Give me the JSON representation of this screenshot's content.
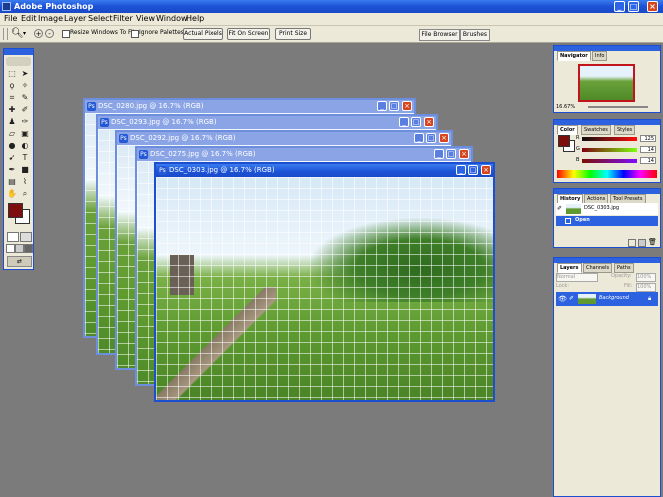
{
  "app": {
    "title": "Adobe Photoshop"
  },
  "menu": [
    "File",
    "Edit",
    "Image",
    "Layer",
    "Select",
    "Filter",
    "View",
    "Window",
    "Help"
  ],
  "options": {
    "resize_label": "Resize Windows To Fit",
    "ignore_label": "Ignore Palettes",
    "actual_pixels": "Actual Pixels",
    "fit_on_screen": "Fit On Screen",
    "print_size": "Print Size",
    "tab_file_browser": "File Browser",
    "tab_brushes": "Brushes"
  },
  "documents": [
    {
      "title": "DSC_0280.jpg @ 16.7% (RGB)"
    },
    {
      "title": "DSC_0293.jpg @ 16.7% (RGB)"
    },
    {
      "title": "DSC_0292.jpg @ 16.7% (RGB)"
    },
    {
      "title": "DSC_0275.jpg @ 16.7% (RGB)"
    },
    {
      "title": "DSC_0303.jpg @ 16.7% (RGB)"
    }
  ],
  "navigator": {
    "tabs": [
      "Navigator",
      "Info"
    ],
    "zoom": "16.67%"
  },
  "color": {
    "tabs": [
      "Color",
      "Swatches",
      "Styles"
    ],
    "channels": [
      {
        "label": "R",
        "value": "125"
      },
      {
        "label": "G",
        "value": "14"
      },
      {
        "label": "B",
        "value": "14"
      }
    ],
    "foreground_color": "#7d0e0e"
  },
  "history": {
    "tabs": [
      "History",
      "Actions",
      "Tool Presets"
    ],
    "snapshot": "DSC_0303.jpg",
    "step": "Open"
  },
  "layers": {
    "tabs": [
      "Layers",
      "Channels",
      "Paths"
    ],
    "blend_mode": "Normal",
    "opacity_label": "Opacity:",
    "opacity": "100%",
    "lock_label": "Lock:",
    "fill_label": "Fill:",
    "fill": "100%",
    "layer_name": "Background"
  }
}
